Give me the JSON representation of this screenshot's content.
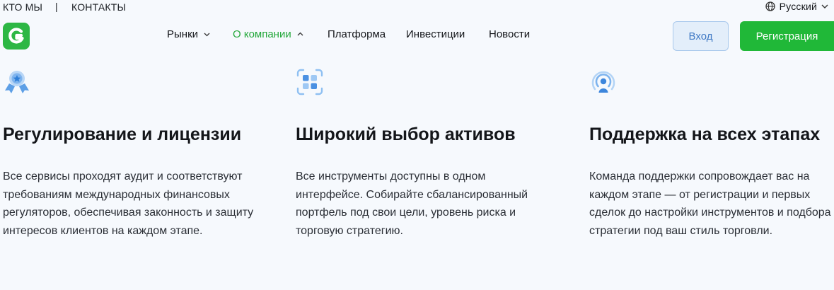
{
  "topbar": {
    "about": "КТО МЫ",
    "separator": "|",
    "contacts": "КОНТАКТЫ",
    "language": "Русский"
  },
  "nav": {
    "items": [
      {
        "label": "Рынки"
      },
      {
        "label": "О компании"
      },
      {
        "label": "Платформа"
      },
      {
        "label": "Инвестиции"
      },
      {
        "label": "Новости"
      }
    ]
  },
  "auth": {
    "login": "Вход",
    "register": "Регистрация"
  },
  "features": [
    {
      "icon": "award-ribbon-icon",
      "title": "Регулирование и лицензии",
      "text": "Все сервисы проходят аудит и соответствуют требованиям международных финансовых регуляторов, обеспечивая законность и защиту интересов клиентов на каждом этапе."
    },
    {
      "icon": "grid-assets-icon",
      "title": "Широкий выбор активов",
      "text": "Все инструменты доступны в одном интерфейсе. Собирайте сбалансированный портфель под свои цели, уровень риска и торговую стратегию."
    },
    {
      "icon": "support-broadcast-icon",
      "title": "Поддержка на всех этапах",
      "text": "Команда поддержки сопровождает вас на каждом этапе — от регистрации и первых сделок до настройки инструментов и подбора стратегии под ваш стиль торговли."
    }
  ],
  "colors": {
    "brand_green": "#20b838",
    "active_nav": "#24a83b",
    "login_bg": "#e3eefa",
    "icon_blue": "#4a90e2"
  }
}
